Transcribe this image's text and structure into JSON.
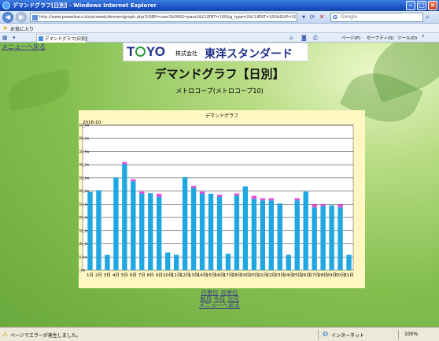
{
  "window": {
    "title": "デマンドグラフ[日別] - Windows Internet Explorer",
    "address": "http://www.powerbaru.biz/ecoweb/demandgraph.php?USER=user1&PASS=pass1&CLIENT=100&g_type=2&CLIENT=100&GUP=10&y",
    "search_placeholder": "Google",
    "favorites_label": "お気に入り",
    "tab_label": "デマンドグラフ[日別]",
    "menu": {
      "page": "ページ(P)",
      "safety": "セーフティ(S)",
      "tools": "ツール(O)",
      "help": "?"
    }
  },
  "page": {
    "menu_link_top": "メニューへ戻る",
    "logo": {
      "toyo": "TOYO",
      "reg": "®",
      "corp": "株式会社",
      "brand": "東洋スタンダード"
    },
    "title": "デマンドグラフ【日別】",
    "subtitle": "メトロコープ(メトロコープ10)",
    "links": {
      "by_day": "日単位",
      "by_month": "月単位",
      "prev_month": "前月",
      "this_month": "今月",
      "next_month": "次月",
      "back_to_menu": "メニューへ戻る"
    }
  },
  "status": {
    "text": "ページでエラーが発生しました。",
    "zone": "インターネット",
    "zoom": "100%"
  },
  "colors": {
    "bar": "#1ea7e0",
    "bar_top": "#e04fd8",
    "panel": "#fff8c2"
  },
  "chart_data": {
    "type": "bar",
    "title": "デマンドグラフ",
    "period": "2016-10",
    "y_ticks": [
      "0_kw",
      "50_kw",
      "100_kw",
      "150_kw",
      "200_kw",
      "250_kw",
      "300_kw",
      "350_kw",
      "400_kw",
      "450_kw",
      "500_kw",
      "550_kw"
    ],
    "ylim": [
      0,
      550
    ],
    "grid": true,
    "categories": [
      "1日",
      "2日",
      "3日",
      "4日",
      "5日",
      "6日",
      "7日",
      "8日",
      "9日",
      "10日",
      "11日",
      "12日",
      "13日",
      "14日",
      "15日",
      "16日",
      "17日",
      "18日",
      "19日",
      "20日",
      "21日",
      "22日",
      "23日",
      "24日",
      "25日",
      "26日",
      "27日",
      "28日",
      "29日",
      "30日",
      "31日"
    ],
    "series": [
      {
        "values": [
          297,
          303,
          58,
          352,
          402,
          337,
          290,
          292,
          278,
          67,
          58,
          353,
          312,
          290,
          290,
          278,
          62,
          283,
          318,
          270,
          265,
          265,
          253,
          58,
          265,
          298,
          238,
          243,
          246,
          238,
          58
        ]
      },
      {
        "values": [
          0,
          0,
          0,
          0,
          8,
          8,
          8,
          0,
          12,
          0,
          0,
          0,
          8,
          8,
          0,
          8,
          0,
          8,
          0,
          12,
          8,
          8,
          0,
          0,
          8,
          0,
          12,
          8,
          0,
          12,
          0
        ]
      }
    ]
  }
}
